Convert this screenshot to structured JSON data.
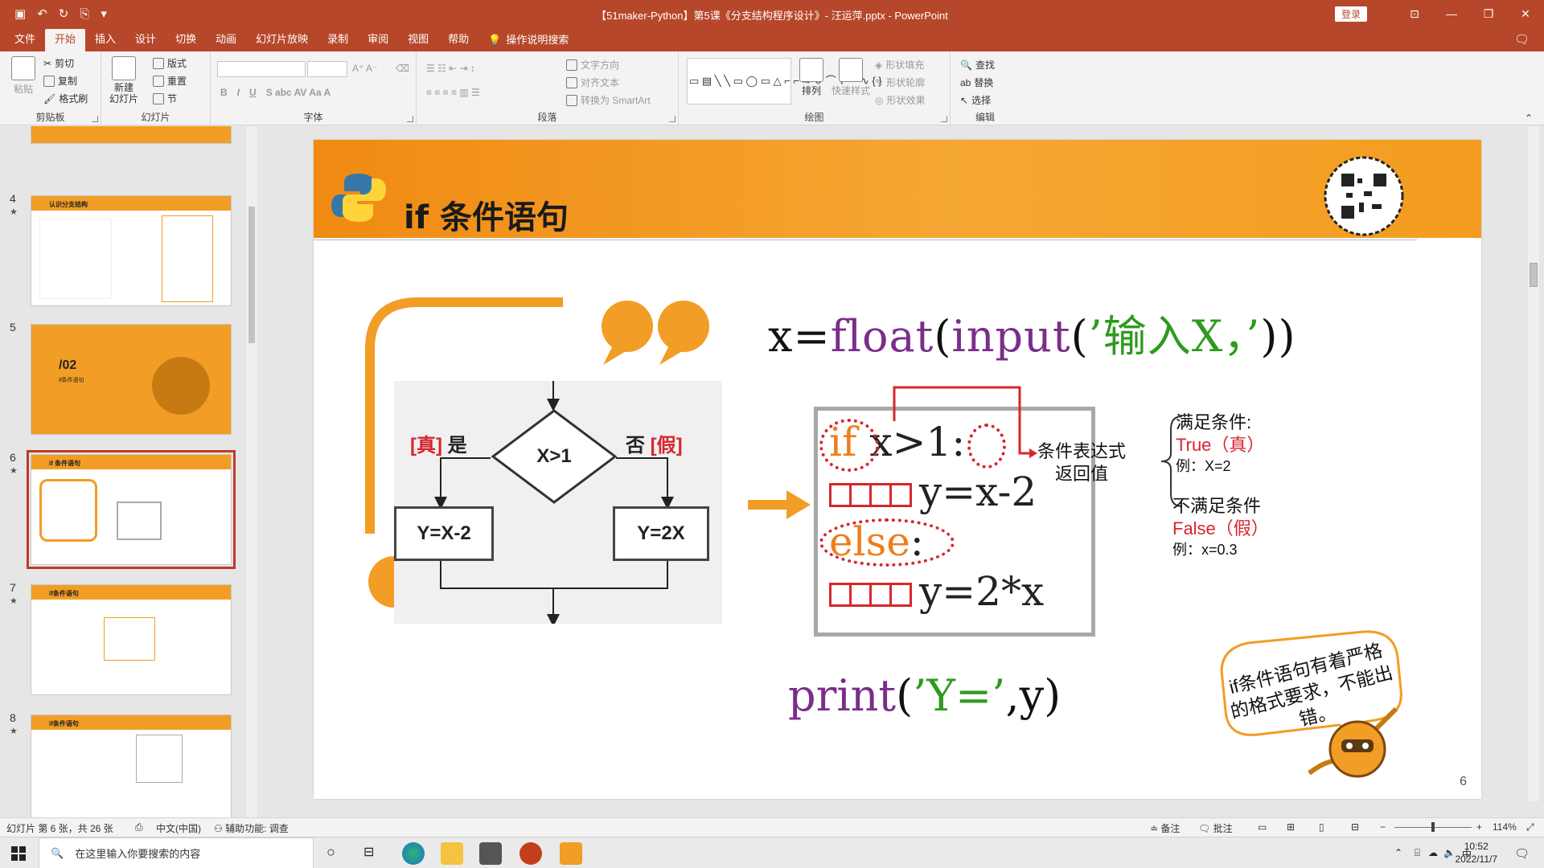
{
  "window": {
    "title": "【51maker-Python】第5课《分支结构程序设计》- 汪运萍.pptx - PowerPoint",
    "login": "登录"
  },
  "tabs": [
    "文件",
    "开始",
    "插入",
    "设计",
    "切换",
    "动画",
    "幻灯片放映",
    "录制",
    "审阅",
    "视图",
    "帮助"
  ],
  "tab_search": "操作说明搜索",
  "ribbon": {
    "clipboard": {
      "label": "剪贴板",
      "paste": "粘贴",
      "cut": "剪切",
      "copy": "复制",
      "format_painter": "格式刷"
    },
    "slides": {
      "label": "幻灯片",
      "new_slide": "新建\n幻灯片",
      "layout": "版式",
      "reset": "重置",
      "section": "节"
    },
    "font": {
      "label": "字体"
    },
    "paragraph": {
      "label": "段落",
      "text_direction": "文字方向",
      "align_text": "对齐文本",
      "smartart": "转换为 SmartArt"
    },
    "drawing": {
      "label": "绘图",
      "arrange": "排列",
      "quick_styles": "快速样式",
      "shape_fill": "形状填充",
      "shape_outline": "形状轮廓",
      "shape_effects": "形状效果"
    },
    "editing": {
      "label": "编辑",
      "find": "查找",
      "replace": "替换",
      "select": "选择"
    }
  },
  "thumbnails": [
    {
      "num": "4",
      "star": "★",
      "title": "认识分支结构"
    },
    {
      "num": "5",
      "star": "",
      "title": "/02",
      "subtitle": "if条件语句"
    },
    {
      "num": "6",
      "star": "★",
      "title": "if 条件语句"
    },
    {
      "num": "7",
      "star": "★",
      "title": "if条件语句"
    },
    {
      "num": "8",
      "star": "★",
      "title": "if条件语句"
    }
  ],
  "slide": {
    "title": "if 条件语句",
    "number": "6",
    "code_top": {
      "x_eq": "x=",
      "float": "float",
      "open": "(",
      "input": "input",
      "open2": "(",
      "prompt": "’输入X，’",
      "close": "))"
    },
    "flow": {
      "true_tag": "[真]",
      "true_word": "是",
      "false_word": "否",
      "false_tag": "[假]",
      "condition": "X>1",
      "yes_branch": "Y=X-2",
      "no_branch": "Y=2X"
    },
    "code_box": {
      "line1_if": "if",
      "line1_cond": " x>1",
      "line1_colon": ":",
      "line2": "y=x-2",
      "line3_else": "else",
      "line3_colon": ":",
      "line4": "y=2*x"
    },
    "cond_label": "条件表达式\n返回值",
    "true_case": {
      "title": "满足条件:",
      "value": "True（真）",
      "example": "例：X=2"
    },
    "false_case": {
      "title": "不满足条件",
      "value": "False（假）",
      "example": "例：x=0.3"
    },
    "print_line": {
      "print": "print",
      "open": "(",
      "str": "’Y=’",
      "rest": ",y)"
    },
    "bubble": "if条件语句有着严格的格式要求，不能出错。"
  },
  "status": {
    "slide_info": "幻灯片 第 6 张，共 26 张",
    "language": "中文(中国)",
    "accessibility": "辅助功能: 调查",
    "notes": "备注",
    "comments": "批注",
    "zoom": "114%"
  },
  "taskbar": {
    "search_placeholder": "在这里输入你要搜索的内容",
    "time": "10:52",
    "date": "2022/11/7",
    "ime": "中"
  },
  "colors": {
    "accent": "#b7472a",
    "orange": "#f29d25",
    "red": "#d7262e",
    "green": "#2e9a1e",
    "purple": "#7b2d8a"
  }
}
